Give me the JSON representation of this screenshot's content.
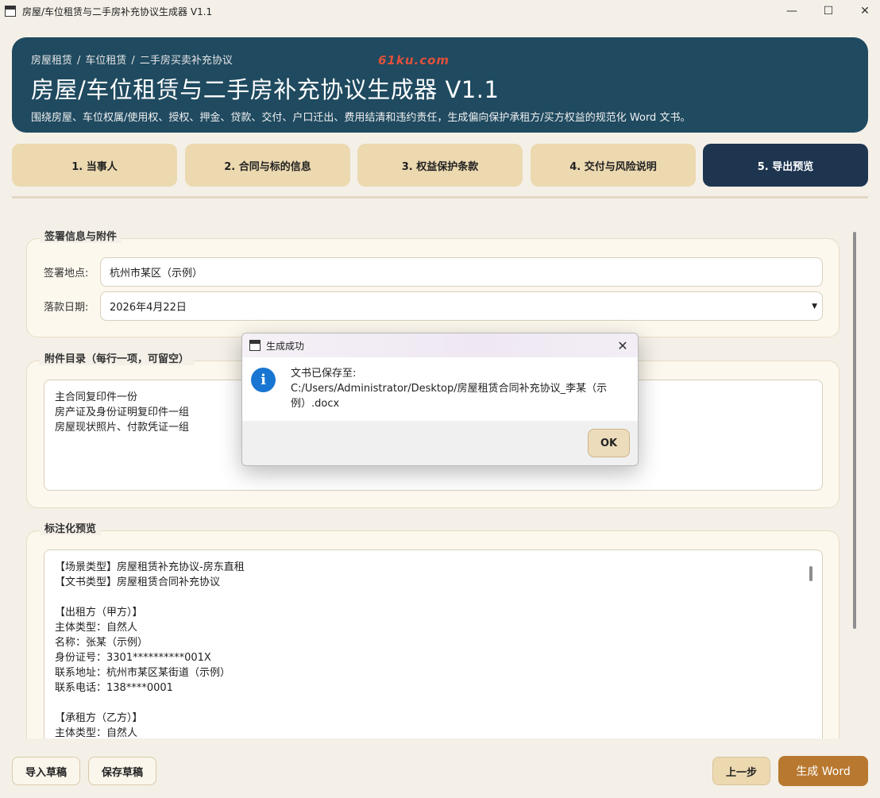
{
  "window": {
    "title": "房屋/车位租赁与二手房补充协议生成器 V1.1",
    "minimize": "—",
    "maximize": "☐",
    "close": "✕"
  },
  "banner": {
    "breadcrumb": [
      "房屋租赁",
      "车位租赁",
      "二手房买卖补充协议"
    ],
    "breadcrumb_sep": "/",
    "title": "房屋/车位租赁与二手房补充协议生成器 V1.1",
    "subtitle": "围绕房屋、车位权属/使用权、授权、押金、贷款、交付、户口迁出、费用结清和违约责任，生成偏向保护承租方/买方权益的规范化 Word 文书。",
    "watermark": "61ku.com"
  },
  "tabs": [
    {
      "label": "1. 当事人",
      "active": false
    },
    {
      "label": "2. 合同与标的信息",
      "active": false
    },
    {
      "label": "3. 权益保护条款",
      "active": false
    },
    {
      "label": "4. 交付与风险说明",
      "active": false
    },
    {
      "label": "5. 导出预览",
      "active": true
    }
  ],
  "signing": {
    "group_title": "签署信息与附件",
    "place_label": "签署地点:",
    "place_value": "杭州市某区（示例）",
    "date_label": "落款日期:",
    "date_value": "2026年4月22日"
  },
  "attachments": {
    "group_title": "附件目录（每行一项，可留空）",
    "lines": [
      "主合同复印件一份",
      "房产证及身份证明复印件一组",
      "房屋现状照片、付款凭证一组"
    ]
  },
  "preview": {
    "group_title": "标注化预览",
    "lines": [
      "【场景类型】房屋租赁补充协议-房东直租",
      "【文书类型】房屋租赁合同补充协议",
      "",
      "【出租方（甲方）】",
      "主体类型：自然人",
      "名称：张某（示例）",
      "身份证号：3301**********001X",
      "联系地址：杭州市某区某街道（示例）",
      "联系电话：138****0001",
      "",
      "【承租方（乙方）】",
      "主体类型：自然人"
    ]
  },
  "footer": {
    "import_label": "导入草稿",
    "save_label": "保存草稿",
    "prev_label": "上一步",
    "generate_label": "生成 Word"
  },
  "dialog": {
    "title": "生成成功",
    "message_line1": "文书已保存至:",
    "message_line2": "C:/Users/Administrator/Desktop/房屋租赁合同补充协议_李某（示",
    "message_line3": "例）.docx",
    "ok_label": "OK",
    "info_glyph": "i"
  }
}
